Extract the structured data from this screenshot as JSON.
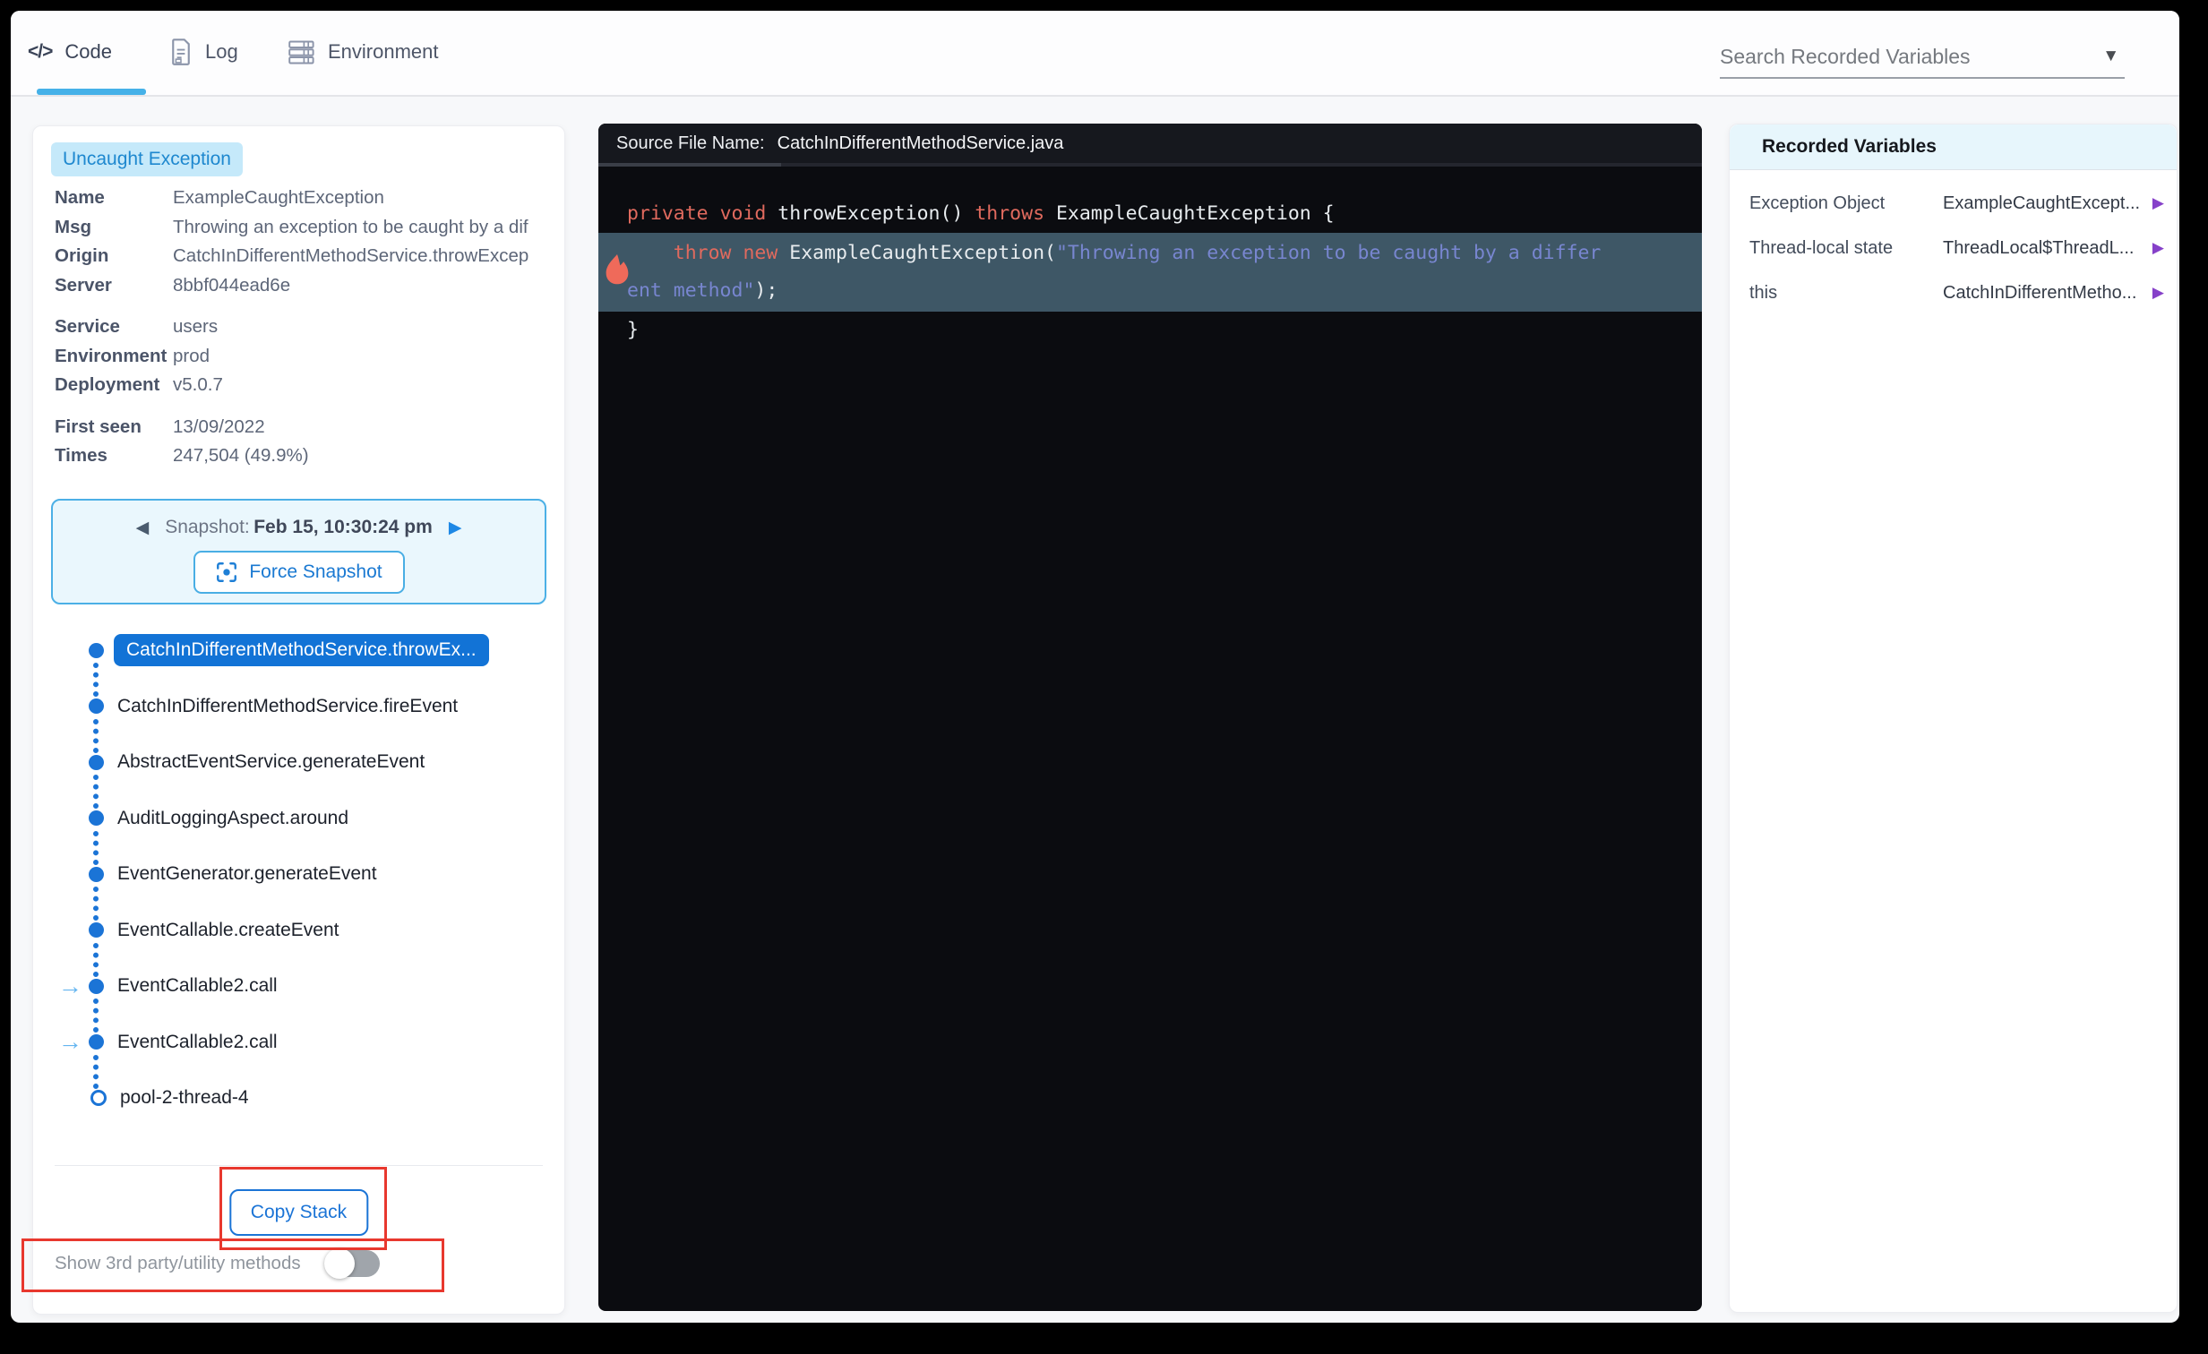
{
  "tabs": [
    {
      "label": "Code"
    },
    {
      "label": "Log"
    },
    {
      "label": "Environment"
    }
  ],
  "search": {
    "placeholder": "Search Recorded Variables"
  },
  "exception": {
    "badge": "Uncaught Exception",
    "groups": [
      [
        {
          "label": "Name",
          "value": "ExampleCaughtException"
        },
        {
          "label": "Msg",
          "value": "Throwing an exception to be caught by a dif"
        },
        {
          "label": "Origin",
          "value": "CatchInDifferentMethodService.throwExcep"
        },
        {
          "label": "Server",
          "value": "8bbf044ead6e"
        }
      ],
      [
        {
          "label": "Service",
          "value": "users"
        },
        {
          "label": "Environment",
          "value": "prod"
        },
        {
          "label": "Deployment",
          "value": "v5.0.7"
        }
      ],
      [
        {
          "label": "First seen",
          "value": "13/09/2022"
        },
        {
          "label": "Times",
          "value": "247,504 (49.9%)"
        }
      ]
    ]
  },
  "snapshot": {
    "prev_icon": "◀",
    "label": "Snapshot:",
    "datetime": "Feb 15, 10:30:24 pm",
    "next_icon": "▶",
    "force_button": "Force Snapshot"
  },
  "stack": {
    "items": [
      {
        "label": "CatchInDifferentMethodService.throwEx...",
        "selected": true,
        "arrow": false,
        "open": false
      },
      {
        "label": "CatchInDifferentMethodService.fireEvent",
        "selected": false,
        "arrow": false,
        "open": false
      },
      {
        "label": "AbstractEventService.generateEvent",
        "selected": false,
        "arrow": false,
        "open": false
      },
      {
        "label": "AuditLoggingAspect.around",
        "selected": false,
        "arrow": false,
        "open": false
      },
      {
        "label": "EventGenerator.generateEvent",
        "selected": false,
        "arrow": false,
        "open": false
      },
      {
        "label": "EventCallable.createEvent",
        "selected": false,
        "arrow": false,
        "open": false
      },
      {
        "label": "EventCallable2.call",
        "selected": false,
        "arrow": true,
        "open": false
      },
      {
        "label": "EventCallable2.call",
        "selected": false,
        "arrow": true,
        "open": false
      },
      {
        "label": "pool-2-thread-4",
        "selected": false,
        "arrow": false,
        "open": true
      }
    ],
    "arrow_glyph": "→",
    "copy_button": "Copy Stack",
    "toggle_label": "Show 3rd party/utility methods",
    "toggle_state": "off"
  },
  "editor": {
    "header_label": "Source File Name:",
    "file_name": "CatchInDifferentMethodService.java",
    "lines": [
      {
        "type": "plain",
        "tokens": [
          [
            "kw",
            "private"
          ],
          [
            "pl",
            " "
          ],
          [
            "kw",
            "void"
          ],
          [
            "pl",
            " throwException() "
          ],
          [
            "kw",
            "throws"
          ],
          [
            "pl",
            " ExampleCaughtException {"
          ]
        ]
      },
      {
        "type": "highlight",
        "flame": true,
        "rows": [
          [
            [
              "pl",
              "    "
            ],
            [
              "kw",
              "throw"
            ],
            [
              "pl",
              " "
            ],
            [
              "kw",
              "new"
            ],
            [
              "pl",
              " ExampleCaughtException("
            ],
            [
              "str",
              "\"Throwing an exception to be caught by a differ"
            ]
          ],
          [
            [
              "str",
              "ent method\""
            ],
            [
              "pl",
              ");"
            ]
          ]
        ]
      },
      {
        "type": "plain",
        "tokens": [
          [
            "pl",
            "}"
          ]
        ]
      }
    ]
  },
  "variables": {
    "title": "Recorded Variables",
    "expander_glyph": "▶",
    "rows": [
      {
        "name": "Exception Object",
        "value": "ExampleCaughtExcept..."
      },
      {
        "name": "Thread-local state",
        "value": "ThreadLocal$ThreadL..."
      },
      {
        "name": "this",
        "value": "CatchInDifferentMetho..."
      }
    ]
  },
  "colors": {
    "primary_blue": "#1b74d6",
    "tab_underline": "#45b1e8",
    "badge_bg": "#c5e9fa",
    "badge_text": "#1e88cf",
    "snapshot_border": "#4cb0e6",
    "code_keyword": "#e06a5e",
    "code_string": "#7886d0",
    "code_highlight_bg": "#3e5766",
    "annotation_red": "#e8382e",
    "expander_purple": "#8641c9"
  }
}
